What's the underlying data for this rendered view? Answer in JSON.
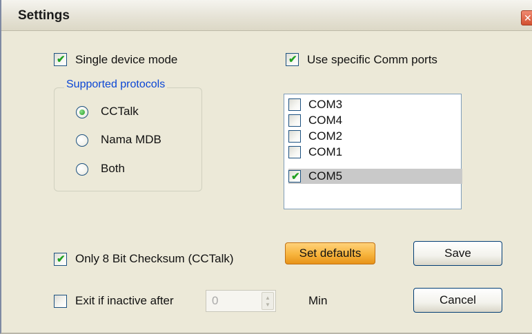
{
  "window": {
    "title": "Settings",
    "close_glyph": "✕"
  },
  "single_device": {
    "label": "Single device mode",
    "checked": true
  },
  "protocols": {
    "legend": "Supported protocols",
    "options": [
      {
        "label": "CCTalk",
        "selected": true
      },
      {
        "label": "Nama MDB",
        "selected": false
      },
      {
        "label": "Both",
        "selected": false
      }
    ]
  },
  "comm_ports": {
    "label": "Use specific Comm ports",
    "checked": true,
    "items": [
      {
        "label": "COM3",
        "checked": false,
        "selected": false
      },
      {
        "label": "COM4",
        "checked": false,
        "selected": false
      },
      {
        "label": "COM2",
        "checked": false,
        "selected": false
      },
      {
        "label": "COM1",
        "checked": false,
        "selected": false
      },
      {
        "label": "COM5",
        "checked": true,
        "selected": true
      }
    ]
  },
  "checksum": {
    "label": "Only 8 Bit Checksum (CCTalk)",
    "checked": true
  },
  "inactive": {
    "label": "Exit if inactive after",
    "checked": false,
    "value": "0",
    "unit": "Min"
  },
  "buttons": {
    "set_defaults": "Set defaults",
    "save": "Save",
    "cancel": "Cancel"
  },
  "check_glyph": "✔",
  "colors": {
    "accent_orange": "#f7b43d",
    "legend_blue": "#0b46d5",
    "check_green": "#21a121",
    "selected_row": "#c9c9c9"
  }
}
